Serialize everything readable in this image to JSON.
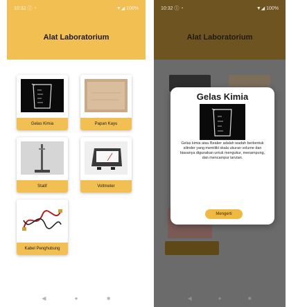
{
  "screen1": {
    "status_left": "10:32 ⓘ ◔",
    "status_right": "▼◢ 100%",
    "title": "Alat Laboratorium",
    "items": [
      {
        "label": "Gelas Kimia",
        "image": "beaker-image"
      },
      {
        "label": "Papan Kayu",
        "image": "wood-board-image"
      },
      {
        "label": "Statif",
        "image": "stand-image"
      },
      {
        "label": "Voltmeter",
        "image": "voltmeter-image"
      },
      {
        "label": "Kabel Penghubung",
        "image": "cables-image"
      }
    ],
    "nav": {
      "back": "◀",
      "home": "●",
      "recent": "■"
    }
  },
  "screen2": {
    "status_left": "10:32 ⓘ ◔",
    "status_right": "▼◢ 100%",
    "title": "Alat Laboratorium",
    "dialog": {
      "title": "Gelas Kimia",
      "description": "Gelas kimia atau Beaker adalah wadah berbentuk silinder yang memiliki skala ukuran volume dan biasanya digunakan untuk mengukur, menampung, dan mencampur larutan.",
      "button": "Mengerti"
    },
    "nav": {
      "back": "◀",
      "home": "●",
      "recent": "■"
    }
  },
  "colors": {
    "accent": "#f2bf52",
    "accent_dimmed": "#6e5420",
    "scrim": "#6b6b6b"
  }
}
